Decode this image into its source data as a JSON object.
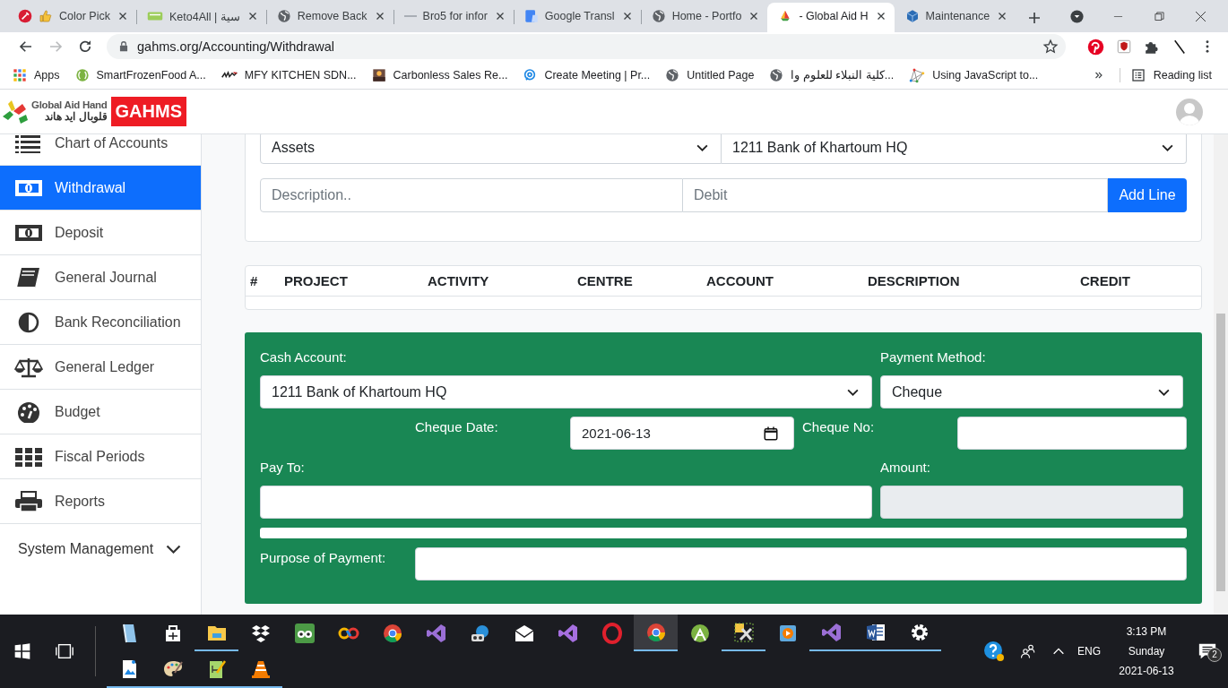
{
  "browser": {
    "tabs": [
      {
        "title": "Color Pick",
        "selected": false
      },
      {
        "title": "Keto4All | سية",
        "selected": false
      },
      {
        "title": "Remove Back",
        "selected": false
      },
      {
        "title": "Bro5 for infor",
        "selected": false
      },
      {
        "title": "Google Transl",
        "selected": false
      },
      {
        "title": "Home - Portfo",
        "selected": false
      },
      {
        "title": "- Global Aid H",
        "selected": true
      },
      {
        "title": "Maintenance",
        "selected": false
      }
    ],
    "address": "gahms.org/Accounting/Withdrawal",
    "bookmarks": [
      "Apps",
      "SmartFrozenFood A...",
      "MFY KITCHEN SDN...",
      "Carbonless Sales Re...",
      "Create Meeting | Pr...",
      "Untitled Page",
      "كلية النبلاء للعلوم وا...",
      "Using JavaScript to..."
    ],
    "reading_list": "Reading list"
  },
  "header": {
    "logo_english": "Global Aid Hand",
    "logo_arabic": "قلوبال ايد هاند",
    "logo_badge": "GAHMS"
  },
  "sidebar": {
    "items": [
      {
        "label": "Chart of Accounts",
        "selected": false
      },
      {
        "label": "Withdrawal",
        "selected": true
      },
      {
        "label": "Deposit",
        "selected": false
      },
      {
        "label": "General Journal",
        "selected": false
      },
      {
        "label": "Bank Reconciliation",
        "selected": false
      },
      {
        "label": "General Ledger",
        "selected": false
      },
      {
        "label": "Budget",
        "selected": false
      },
      {
        "label": "Fiscal Periods",
        "selected": false
      },
      {
        "label": "Reports",
        "selected": false
      }
    ],
    "section": {
      "label": "System Management",
      "expanded": false
    }
  },
  "entry_form": {
    "account_type": "Assets",
    "account": "1211 Bank of Khartoum HQ",
    "description": {
      "placeholder": "Description.."
    },
    "debit": {
      "placeholder": "Debit"
    },
    "add_button": "Add Line"
  },
  "table": {
    "columns": [
      "#",
      "PROJECT",
      "ACTIVITY",
      "CENTRE",
      "ACCOUNT",
      "DESCRIPTION",
      "CREDIT"
    ]
  },
  "payment": {
    "cash_account": {
      "label": "Cash Account:",
      "value": "1211 Bank of Khartoum HQ"
    },
    "payment_method": {
      "label": "Payment Method:",
      "value": "Cheque"
    },
    "cheque_date": {
      "label": "Cheque Date:",
      "value": "2021-06-13"
    },
    "cheque_no": {
      "label": "Cheque No:"
    },
    "pay_to": {
      "label": "Pay To:"
    },
    "amount": {
      "label": "Amount:",
      "disabled": true
    },
    "purpose": {
      "label": "Purpose of Payment:"
    }
  },
  "taskbar": {
    "apps": [
      {
        "running": false,
        "selected": false
      },
      {
        "running": false,
        "selected": false
      },
      {
        "running": true,
        "selected": false
      },
      {
        "running": false,
        "selected": false
      },
      {
        "running": false,
        "selected": false
      },
      {
        "running": false,
        "selected": false
      },
      {
        "running": false,
        "selected": false
      },
      {
        "running": false,
        "selected": false
      },
      {
        "running": false,
        "selected": false
      },
      {
        "running": false,
        "selected": false
      },
      {
        "running": false,
        "selected": false
      },
      {
        "running": false,
        "selected": false
      },
      {
        "running": true,
        "selected": true
      },
      {
        "running": false,
        "selected": false
      },
      {
        "running": true,
        "selected": false
      },
      {
        "running": false,
        "selected": false
      },
      {
        "running": true,
        "selected": false
      },
      {
        "running": true,
        "selected": false
      },
      {
        "running": true,
        "selected": false
      },
      {
        "running": true,
        "selected": false
      },
      {
        "running": true,
        "selected": false
      },
      {
        "running": true,
        "selected": false
      },
      {
        "running": true,
        "selected": false
      }
    ],
    "tray": {
      "language": "ENG",
      "time": "3:13 PM",
      "day": "Sunday",
      "date": "2021-06-13",
      "notifications": "2"
    }
  }
}
